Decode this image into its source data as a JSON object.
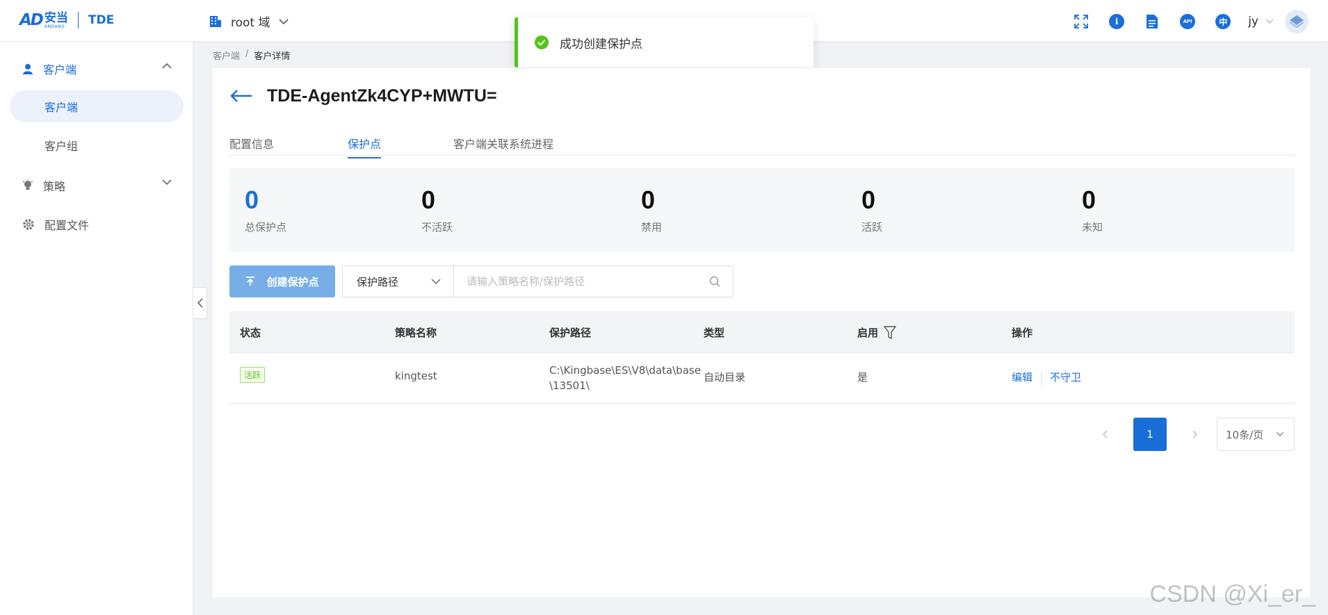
{
  "header": {
    "logo_cn": "安当",
    "logo_en": "ANDANG",
    "product": "TDE",
    "domain": "root 域",
    "user": "jy"
  },
  "sidebar": {
    "client_group": "客户端",
    "items": [
      {
        "label": "客户端",
        "active": true
      },
      {
        "label": "客户组",
        "active": false
      }
    ],
    "policy": "策略",
    "profile": "配置文件"
  },
  "breadcrumb": {
    "parent": "客户端",
    "sep": "/",
    "current": "客户详情"
  },
  "page": {
    "title": "TDE-AgentZk4CYP+MWTU="
  },
  "tabs": [
    {
      "label": "配置信息",
      "active": false
    },
    {
      "label": "保护点",
      "active": true
    },
    {
      "label": "客户端关联系统进程",
      "active": false
    }
  ],
  "stats": [
    {
      "value": "0",
      "label": "总保护点"
    },
    {
      "value": "0",
      "label": "不活跃"
    },
    {
      "value": "0",
      "label": "禁用"
    },
    {
      "value": "0",
      "label": "活跃"
    },
    {
      "value": "0",
      "label": "未知"
    }
  ],
  "toolbar": {
    "create_label": "创建保护点",
    "filter_selected": "保护路径",
    "search_placeholder": "请输入策略名称/保护路径"
  },
  "table": {
    "columns": [
      "状态",
      "策略名称",
      "保护路径",
      "类型",
      "启用",
      "操作"
    ],
    "rows": [
      {
        "status": "活跃",
        "policy": "kingtest",
        "path_line1": "C:\\Kingbase\\ES\\V8\\data\\base",
        "path_line2": "\\13501\\",
        "type": "自动目录",
        "enabled": "是",
        "action_edit": "编辑",
        "action_unguard": "不守卫"
      }
    ]
  },
  "pagination": {
    "current": "1",
    "page_size": "10条/页"
  },
  "toast": {
    "message": "成功创建保护点"
  },
  "watermark": "CSDN @Xi_er_",
  "colors": {
    "primary": "#1a6ed8",
    "success": "#52c41a",
    "button_disabled": "#77aee8"
  }
}
